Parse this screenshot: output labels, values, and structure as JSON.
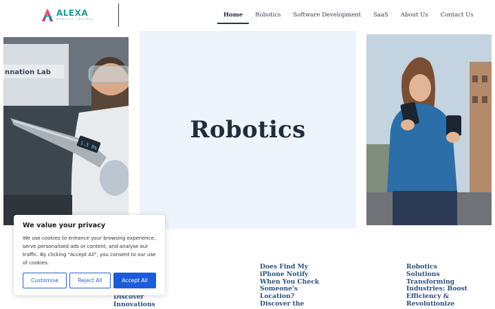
{
  "header": {
    "logo": {
      "title": "ALEXA",
      "subtitle": "ROBOTIC CENTRAL"
    },
    "nav": [
      {
        "label": "Home",
        "active": true
      },
      {
        "label": "Robotics",
        "active": false
      },
      {
        "label": "Software Development",
        "active": false
      },
      {
        "label": "SaaS",
        "active": false
      },
      {
        "label": "About Us",
        "active": false
      },
      {
        "label": "Contact Us",
        "active": false
      }
    ]
  },
  "hero": {
    "title": "Robotics",
    "left_image": {
      "sign_text": "nnation Lab",
      "device_readout": "1.5 0%"
    }
  },
  "articles": [
    {
      "lines": [
        "Discover",
        "Innovations"
      ]
    },
    {
      "lines": [
        "Does Find My",
        "iPhone Notify",
        "When You Check",
        "Someone's",
        "Location?",
        "Discover the"
      ]
    },
    {
      "lines": [
        "Robotics",
        "Solutions",
        "Transforming",
        "Industries: Boost",
        "Efficiency &",
        "Revolutionize"
      ]
    }
  ],
  "cookie_banner": {
    "title": "We value your privacy",
    "text": "We use cookies to enhance your browsing experience, serve personalised ads or content, and analyse our traffic. By clicking \"Accept All\", you consent to our use of cookies.",
    "buttons": {
      "customise": "Customise",
      "reject": "Reject All",
      "accept": "Accept All"
    }
  },
  "colors": {
    "accent": "#1d5cd8",
    "article_link": "#2c4f7c",
    "panel_bg": "#eef4fc"
  }
}
